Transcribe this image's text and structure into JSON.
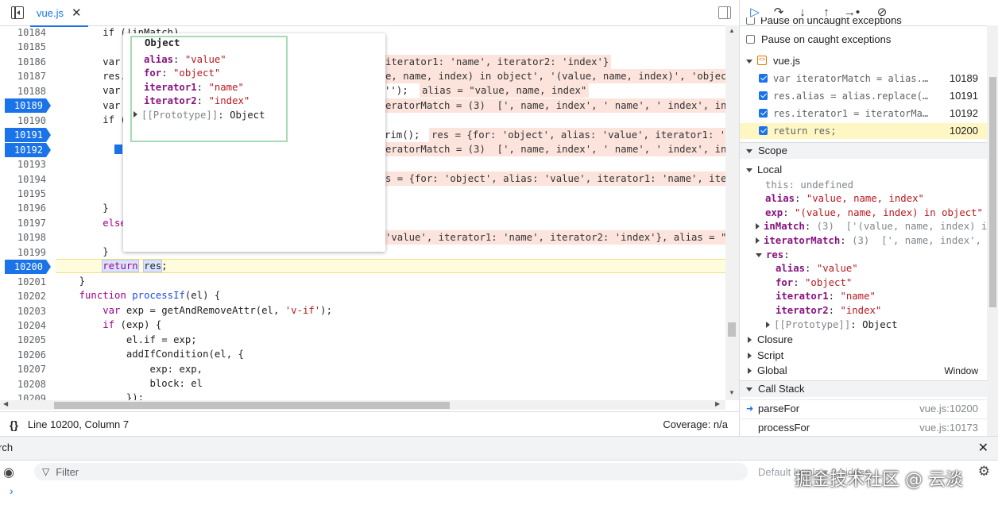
{
  "editor": {
    "file_tab": "vue.js",
    "tab_close": "✕",
    "status_braces": "{}",
    "status_position": "Line 10200, Column 7",
    "status_coverage": "Coverage: n/a",
    "gutter": [
      {
        "n": "10184",
        "bp": false
      },
      {
        "n": "10185",
        "bp": false
      },
      {
        "n": "10186",
        "bp": false
      },
      {
        "n": "10187",
        "bp": false
      },
      {
        "n": "10188",
        "bp": false
      },
      {
        "n": "10189",
        "bp": true
      },
      {
        "n": "10190",
        "bp": false
      },
      {
        "n": "10191",
        "bp": true
      },
      {
        "n": "10192",
        "bp": true
      },
      {
        "n": "10193",
        "bp": false
      },
      {
        "n": "10194",
        "bp": false
      },
      {
        "n": "10195",
        "bp": false
      },
      {
        "n": "10196",
        "bp": false
      },
      {
        "n": "10197",
        "bp": false
      },
      {
        "n": "10198",
        "bp": false
      },
      {
        "n": "10199",
        "bp": false
      },
      {
        "n": "10200",
        "bp": true
      },
      {
        "n": "10201",
        "bp": false
      },
      {
        "n": "10202",
        "bp": false
      },
      {
        "n": "10203",
        "bp": false
      },
      {
        "n": "10204",
        "bp": false
      },
      {
        "n": "10205",
        "bp": false
      },
      {
        "n": "10206",
        "bp": false
      },
      {
        "n": "10207",
        "bp": false
      },
      {
        "n": "10208",
        "bp": false
      },
      {
        "n": "10209",
        "bp": false
      }
    ],
    "code": {
      "l10184": "        if (!inMatch)",
      "l10185": "            re",
      "l10186a": "        var re",
      "l10186b": "iterator1: 'name', iterator2: 'index'}",
      "l10187a": "        res.fo",
      "l10187b": "e, name, index) in object', '(value, name, index)', 'object',",
      "l10188a": "        var al",
      "l10188b": "'');",
      "l10188c": "alias = \"value, name, index\"",
      "l10189a": "        var it",
      "l10189b": "eratorMatch = (3)  [', name, index', ' name', ' index', index:",
      "l10190": "        if (it",
      "l10191a": "            re",
      "l10191b": "rim();",
      "l10191c": "res = {for: 'object', alias: 'value', iterator1: 'nam",
      "l10192b": "eratorMatch = (3)  [', name, index', ' name', ' index', index:",
      "l10193": "            if",
      "l10194b": "s = {for: 'object', alias: 'value', iterator1: 'name', iterato",
      "l10195": "            }",
      "l10196": "        }",
      "l10197": "        else",
      "l10198a": "            re",
      "l10198b": "'value', iterator1: 'name', iterator2: 'index'}, alias = \"va",
      "l10199": "        }",
      "l10200_kw": "return",
      "l10200_var": "res",
      "l10200_end": ";",
      "l10201": "    }",
      "l10202_kw": "function",
      "l10202_fn": "processIf",
      "l10202_rest": "(el) {",
      "l10203_kw": "var",
      "l10203_rest1": " exp = getAndRemoveAttr(el, ",
      "l10203_str": "'v-if'",
      "l10203_rest2": ");",
      "l10204_kw": "if",
      "l10204_rest": " (exp) {",
      "l10205": "            el.if = exp;",
      "l10206": "            addIfCondition(el, {",
      "l10207": "                exp: exp,",
      "l10208": "                block: el",
      "l10209": "            });"
    }
  },
  "popover": {
    "title": "Object",
    "alias_key": "alias",
    "alias_val": "\"value\"",
    "for_key": "for",
    "for_val": "\"object\"",
    "it1_key": "iterator1",
    "it1_val": "\"name\"",
    "it2_key": "iterator2",
    "it2_val": "\"index\"",
    "proto": "[[Prototype]]",
    "proto_val": "Object"
  },
  "sidebar": {
    "pause_uncaught": "Pause on uncaught exceptions",
    "pause_caught": "Pause on caught exceptions",
    "bp_file": "vue.js",
    "breakpoints": [
      {
        "code": "var iteratorMatch = alias.m…",
        "line": "10189"
      },
      {
        "code": "res.alias = alias.replace(f…",
        "line": "10191"
      },
      {
        "code": "res.iterator1 = iteratorMat…",
        "line": "10192"
      },
      {
        "code": "return res;",
        "line": "10200"
      }
    ],
    "scope_title": "Scope",
    "local_title": "Local",
    "this_row": "this: undefined",
    "alias_k": "alias",
    "alias_v": "\"value, name, index\"",
    "exp_k": "exp",
    "exp_v": "\"(value, name, index) in object\"",
    "inMatch_k": "inMatch",
    "inMatch_v": "(3)  ['(value, name, index) in",
    "iteratorMatch_k": "iteratorMatch",
    "iteratorMatch_v": "(3)  [', name, index',",
    "res_k": "res",
    "res_alias_k": "alias",
    "res_alias_v": "\"value\"",
    "res_for_k": "for",
    "res_for_v": "\"object\"",
    "res_it1_k": "iterator1",
    "res_it1_v": "\"name\"",
    "res_it2_k": "iterator2",
    "res_it2_v": "\"index\"",
    "res_proto": "[[Prototype]]",
    "res_proto_v": "Object",
    "closure": "Closure",
    "script": "Script",
    "global": "Global",
    "global_val": "Window",
    "callstack_title": "Call Stack",
    "frames": [
      {
        "name": "parseFor",
        "loc": "vue.js:10200"
      },
      {
        "name": "processFor",
        "loc": "vue.js:10173"
      }
    ]
  },
  "drawer": {
    "tab_label": "rch",
    "close": "✕",
    "filter_placeholder": "Filter",
    "levels": "Default levels ▾",
    "hidden": "2 hidden",
    "prompt": "›"
  },
  "watermark": "掘金技术社区 @ 云淡"
}
